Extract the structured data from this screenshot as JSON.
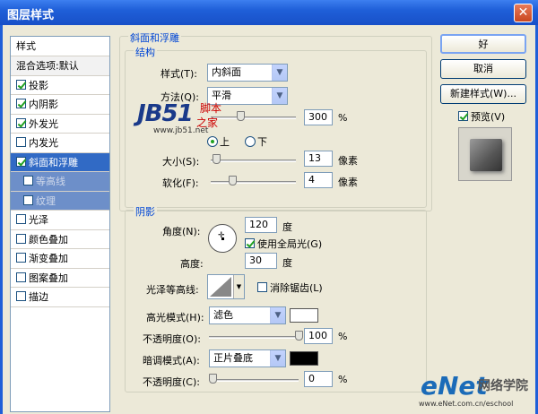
{
  "window": {
    "title": "图层样式",
    "close_glyph": "✕"
  },
  "styles_list": {
    "header": "样式",
    "blend": "混合选项:默认",
    "items": [
      {
        "label": "投影",
        "checked": true
      },
      {
        "label": "内阴影",
        "checked": true
      },
      {
        "label": "外发光",
        "checked": true
      },
      {
        "label": "内发光",
        "checked": false
      },
      {
        "label": "斜面和浮雕",
        "checked": true,
        "selected": true
      },
      {
        "label": "等高线",
        "checked": false,
        "sub": true
      },
      {
        "label": "纹理",
        "checked": false,
        "sub": true
      },
      {
        "label": "光泽",
        "checked": false
      },
      {
        "label": "颜色叠加",
        "checked": false
      },
      {
        "label": "渐变叠加",
        "checked": false
      },
      {
        "label": "图案叠加",
        "checked": false
      },
      {
        "label": "描边",
        "checked": false
      }
    ]
  },
  "bevel": {
    "group_title": "斜面和浮雕",
    "structure_title": "结构",
    "style_label": "样式(T):",
    "style_value": "内斜面",
    "technique_label": "方法(Q):",
    "technique_value": "平滑",
    "depth_value": "300",
    "depth_unit": "%",
    "depth_level": 0.3,
    "direction_up": "上",
    "direction_down": "下",
    "size_label": "大小(S):",
    "size_value": "13",
    "size_unit": "像素",
    "soften_label": "软化(F):",
    "soften_value": "4",
    "soften_unit": "像素"
  },
  "shading": {
    "title": "阴影",
    "angle_label": "角度(N):",
    "angle_value": "120",
    "angle_unit": "度",
    "global_light_label": "使用全局光(G)",
    "altitude_label": "高度:",
    "altitude_value": "30",
    "altitude_unit": "度",
    "gloss_label": "光泽等高线:",
    "antialias_label": "消除锯齿(L)",
    "highlight_mode_label": "高光模式(H):",
    "highlight_mode_value": "滤色",
    "highlight_color": "#ffffff",
    "highlight_opacity_label": "不透明度(O):",
    "highlight_opacity_value": "100",
    "shadow_mode_label": "暗调模式(A):",
    "shadow_mode_value": "正片叠底",
    "shadow_color": "#000000",
    "shadow_opacity_label": "不透明度(C):",
    "shadow_opacity_value": "0",
    "percent": "%"
  },
  "buttons": {
    "ok": "好",
    "cancel": "取消",
    "new_style": "新建样式(W)...",
    "preview": "预览(V)"
  },
  "watermarks": {
    "jb51_logo": "JB51",
    "jb51_url": "www.jb51.net",
    "jb51_cn_1": "脚本",
    "jb51_cn_2": "之家",
    "enet_logo": "eNet",
    "enet_cn": "网络学院",
    "enet_url": "www.eNet.com.cn/eschool"
  }
}
